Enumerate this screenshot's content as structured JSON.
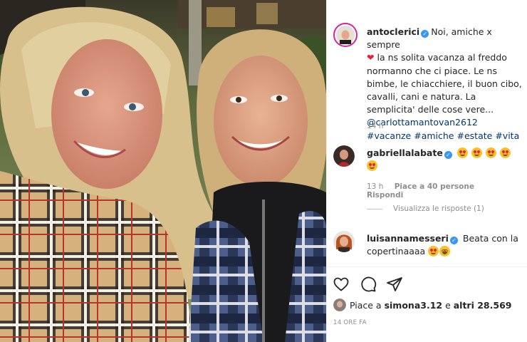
{
  "post": {
    "username": "antoclerici",
    "caption_line1": "Noi, amiche x sempre",
    "caption_rest": "la ns solita vacanza al freddo normanno che ci piace. Le ns bimbe, le chiacchiere, il buon cibo, cavalli, cani e natura. La semplicita' delle cose vere...",
    "mention": "@carlottamantovan2612",
    "hashtags": [
      "#vacanze",
      "#amiche",
      "#estate",
      "#vita"
    ],
    "time": "14 h"
  },
  "comments": [
    {
      "username": "gabriellalabate",
      "emoji_count": 5,
      "time": "13 h",
      "likes": "Piace a 40 persone",
      "reply": "Rispondi",
      "view_replies": "Visualizza le risposte (1)"
    },
    {
      "username": "luisannamesseri",
      "text": "Beata con la copertinaaaa"
    }
  ],
  "actions": {
    "icons": [
      "heart-icon",
      "comment-icon",
      "share-icon"
    ]
  },
  "likes": {
    "prefix": "Piace a ",
    "user": "simona3.12",
    "middle": " e ",
    "others": "altri 28.569"
  },
  "timestamp": "14 ORE FA",
  "colors": {
    "verified": "#3897f0",
    "link": "#00376b",
    "secondary_text": "#8e8e8e",
    "story_ring": "#d6249f"
  }
}
